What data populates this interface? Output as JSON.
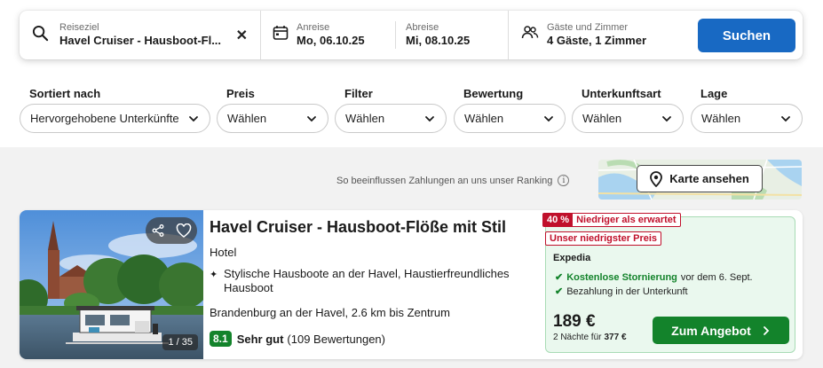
{
  "search": {
    "destination_label": "Reiseziel",
    "destination_value": "Havel Cruiser - Hausboot-Fl...",
    "checkin_label": "Anreise",
    "checkin_value": "Mo, 06.10.25",
    "checkout_label": "Abreise",
    "checkout_value": "Mi, 08.10.25",
    "guests_label": "Gäste und Zimmer",
    "guests_value": "4 Gäste, 1 Zimmer",
    "search_button": "Suchen"
  },
  "filters": [
    {
      "label": "Sortiert nach",
      "value": "Hervorgehobene Unterkünfte"
    },
    {
      "label": "Preis",
      "value": "Wählen"
    },
    {
      "label": "Filter",
      "value": "Wählen"
    },
    {
      "label": "Bewertung",
      "value": "Wählen"
    },
    {
      "label": "Unterkunftsart",
      "value": "Wählen"
    },
    {
      "label": "Lage",
      "value": "Wählen"
    }
  ],
  "ranking_note": "So beeinflussen Zahlungen an uns unser Ranking",
  "map_button": "Karte ansehen",
  "hotel": {
    "name": "Havel Cruiser - Hausboot-Flöße mit Stil",
    "type": "Hotel",
    "feature": "Stylische Hausboote an der Havel, Haustierfreundliches Hausboot",
    "location": "Brandenburg an der Havel, 2.6 km bis Zentrum",
    "rating_score": "8.1",
    "rating_word": "Sehr gut",
    "rating_count": "(109 Bewertungen)",
    "photo_count": "1 / 35"
  },
  "deal": {
    "discount_pct": "40 %",
    "discount_text": "Niedriger als erwartet",
    "lowest_badge": "Unser niedrigster Preis",
    "provider": "Expedia",
    "perk1_bold": "Kostenlose Stornierung",
    "perk1_rest": "vor dem 6. Sept.",
    "perk2": "Bezahlung in der Unterkunft",
    "price": "189 €",
    "nights_text": "2 Nächte für",
    "nights_total": "377 €",
    "offer_button": "Zum Angebot"
  },
  "colors": {
    "search_button": "#1869c3",
    "offer_button": "#13832b",
    "badge_red": "#c0102b",
    "deal_bg": "#eaf8ee",
    "results_bg": "#f2f2f2"
  },
  "icons": [
    "search-icon",
    "calendar-icon",
    "guests-icon",
    "close-icon",
    "chevron-down-icon",
    "info-icon",
    "map-pin-icon",
    "share-icon",
    "heart-icon",
    "check-icon",
    "sparkle-icon",
    "chevron-right-icon"
  ]
}
